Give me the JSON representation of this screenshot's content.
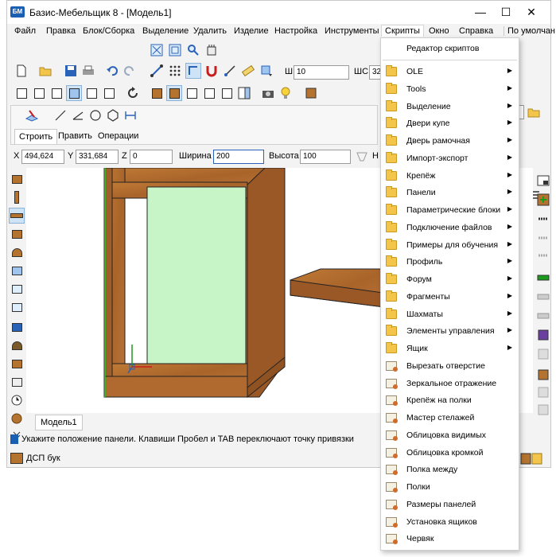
{
  "window": {
    "app_icon_text": "БМ",
    "title": "Базис-Мебельщик 8 - [Модель1]",
    "minimize": "—",
    "maximize": "☐",
    "close": "✕"
  },
  "menu": {
    "file": "Файл",
    "edit": "Правка",
    "block": "Блок/Сборка",
    "selection": "Выделение",
    "delete": "Удалить",
    "product": "Изделие",
    "settings": "Настройка",
    "tools": "Инструменты",
    "scripts": "Скрипты",
    "window": "Окно",
    "help": "Справка",
    "default": "По умолчан"
  },
  "toolbar": {
    "step_label": "Ш",
    "step_value": "10",
    "shc_label": "ШС",
    "shc_value": "32",
    "right_value": "32"
  },
  "tabs": {
    "build": "Строить",
    "edit": "Править",
    "operations": "Операции"
  },
  "coords": {
    "x_label": "X",
    "x_value": "494,624",
    "y_label": "Y",
    "y_value": "331,684",
    "z_label": "Z",
    "z_value": "0",
    "width_label": "Ширина",
    "width_value": "200",
    "height_label": "Высота",
    "height_value": "100",
    "cut_label": "Н"
  },
  "model_tab": "Модель1",
  "status": {
    "hint": "Укажите положение панели. Клавиши Пробел и TAB переключают точку привязки",
    "material": "ДСП бук"
  },
  "colors": {
    "wood": "#b4742f",
    "panel_green": "#c8f5c8",
    "menu_highlight": "#cfe3f7"
  },
  "scripts_menu": {
    "header": "Редактор скриптов",
    "folders": [
      "OLE",
      "Tools",
      "Выделение",
      "Двери купе",
      "Дверь рамочная",
      "Импорт-экспорт",
      "Крепёж",
      "Панели",
      "Параметрические блоки",
      "Подключение файлов",
      "Примеры для обучения",
      "Профиль",
      "Форум",
      "Фрагменты",
      "Шахматы",
      "Элементы управления",
      "Ящик"
    ],
    "scripts": [
      "Вырезать отверстие",
      "Зеркальное отражение",
      "Крепёж на полки",
      "Мастер стелажей",
      "Облицовка видимых",
      "Облицовка кромкой",
      "Полка между",
      "Полки",
      "Размеры панелей",
      "Установка ящиков",
      "Червяк"
    ],
    "submenu_arrow": "▶"
  }
}
